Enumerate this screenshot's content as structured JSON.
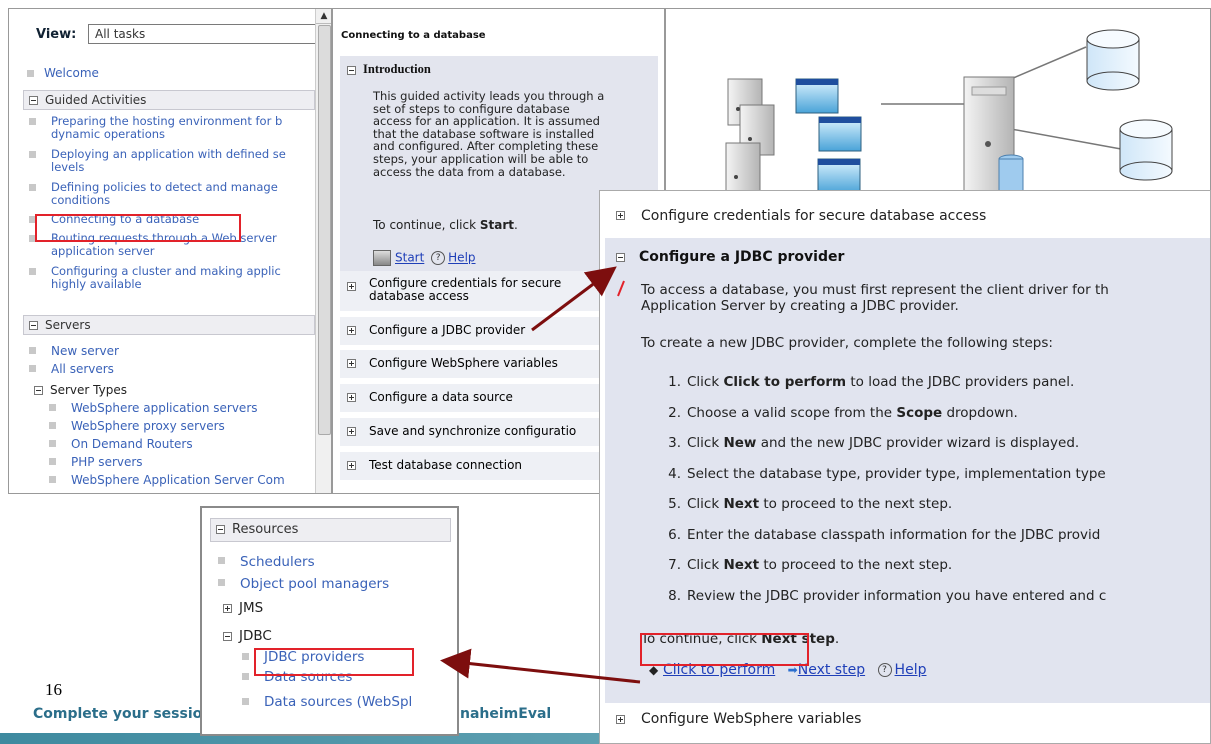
{
  "nav": {
    "view_label": "View:",
    "view_value": "All tasks",
    "welcome": "Welcome",
    "guided_header": "Guided Activities",
    "guided_items": [
      [
        "Preparing the hosting environment for b",
        "dynamic operations"
      ],
      [
        "Deploying an application with defined se",
        "levels"
      ],
      [
        "Defining policies to detect and manage",
        "conditions"
      ],
      [
        "Connecting to a database"
      ],
      [
        "Routing requests through a Web server",
        "application server"
      ],
      [
        "Configuring a cluster and making applic",
        "highly available"
      ]
    ],
    "servers_header": "Servers",
    "servers_items": [
      "New server",
      "All servers"
    ],
    "server_types_header": "Server Types",
    "server_types_items": [
      "WebSphere application servers",
      "WebSphere proxy servers",
      "On Demand Routers",
      "PHP servers",
      "WebSphere Application Server Com"
    ]
  },
  "middle": {
    "title": "Connecting to a database",
    "intro_header": "Introduction",
    "intro_lines": [
      "This guided activity leads you through a",
      "set of steps to configure database",
      "access for an application. It is assumed",
      "that the database software is installed",
      "and configured. After completing these",
      "steps, your application will be able to",
      "access the data from a database."
    ],
    "continue_prefix": "To continue, click ",
    "continue_bold": "Start",
    "continue_suffix": ".",
    "start_label": "Start",
    "help_label": "Help",
    "sections": [
      "Configure credentials for secure database access",
      "Configure a JDBC provider",
      "Configure WebSphere variables",
      "Configure a data source",
      "Save and synchronize configuratio",
      "Test database connection"
    ]
  },
  "zoom": {
    "top_section": "Configure credentials for secure database access",
    "section_title": "Configure a JDBC provider",
    "desc_lines": [
      "To access a database, you must first represent the client driver for th",
      "Application Server by creating a JDBC provider."
    ],
    "steps_intro": "To create a new JDBC provider, complete the following steps:",
    "steps": [
      {
        "n": "1.",
        "pre": "Click ",
        "bold": "Click to perform",
        "post": " to load the JDBC providers panel."
      },
      {
        "n": "2.",
        "pre": "Choose a valid scope from the ",
        "bold": "Scope",
        "post": " dropdown."
      },
      {
        "n": "3.",
        "pre": "Click ",
        "bold": "New",
        "post": " and the new JDBC provider wizard is displayed."
      },
      {
        "n": "4.",
        "pre": "Select the database type, provider type, implementation type",
        "bold": "",
        "post": ""
      },
      {
        "n": "5.",
        "pre": "Click ",
        "bold": "Next",
        "post": " to proceed to the next step."
      },
      {
        "n": "6.",
        "pre": "Enter the database classpath information for the JDBC provid",
        "bold": "",
        "post": ""
      },
      {
        "n": "7.",
        "pre": "Click ",
        "bold": "Next",
        "post": " to proceed to the next step."
      },
      {
        "n": "8.",
        "pre": "Review the JDBC provider information you have entered and c",
        "bold": "",
        "post": ""
      }
    ],
    "continue_prefix": "To continue, click ",
    "continue_bold": "Next step",
    "continue_suffix": ".",
    "click_to_perform": "Click to perform",
    "next_step": "Next step",
    "help_label": "Help",
    "bottom_section": "Configure WebSphere variables"
  },
  "resources": {
    "header": "Resources",
    "items": [
      "Schedulers",
      "Object pool managers"
    ],
    "jms": "JMS",
    "jdbc": "JDBC",
    "jdbc_items": [
      "JDBC providers",
      "Data sources",
      "Data sources (WebSpl"
    ]
  },
  "slide": {
    "page_number": "16",
    "footer_left": "Complete your session",
    "footer_right": "naheimEval"
  }
}
